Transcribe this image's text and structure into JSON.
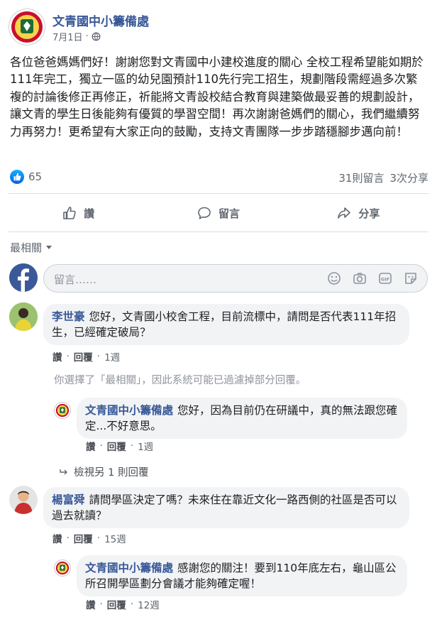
{
  "post": {
    "page_name": "文青國中小籌備處",
    "date": "7月1日",
    "privacy_icon": "globe-icon",
    "text": "各位爸爸媽媽們好！謝謝您對文青國中小建校進度的關心 全校工程希望能如期於111年完工，獨立一區的幼兒園預計110先行完工招生，規劃階段需經過多次繁複的討論後修正再修正，祈能將文青設校結合教育與建築做最妥善的規劃設計，讓文青的學生日後能夠有優質的學習空間！再次謝謝爸媽們的關心，我們繼續努力再努力！更希望有大家正向的鼓勵，支持文青團隊一步步踏穩腳步邁向前！",
    "reaction_count": "65",
    "comment_count": "31則留言",
    "share_count": "3次分享"
  },
  "actions": {
    "like": "讚",
    "comment": "留言",
    "share": "分享"
  },
  "sort": {
    "label": "最相關"
  },
  "composer": {
    "placeholder": "留言……"
  },
  "comments": [
    {
      "author": "李世豪",
      "text": "您好，文青國小校舍工程，目前流標中，請問是否代表111年招生，已經確定破局？",
      "like_label": "讚",
      "reply_label": "回覆",
      "time": "1週",
      "filter_note": "你選擇了「最相關」，因此系統可能已過濾掉部分回覆。",
      "reply": {
        "author": "文青國中小籌備處",
        "text": "您好，因為目前仍在研議中，真的無法跟您確定...不好意思。",
        "like_label": "讚",
        "reply_label": "回覆",
        "time": "1週"
      },
      "more_replies": "檢視另 1 則回覆"
    },
    {
      "author": "楊富舜",
      "text": "請問學區決定了嗎？未來住在靠近文化一路西側的社區是否可以過去就讀？",
      "like_label": "讚",
      "reply_label": "回覆",
      "time": "15週",
      "reply": {
        "author": "文青國中小籌備處",
        "text": "感謝您的關注！要到110年底左右，龜山區公所召開學區劃分會議才能夠確定喔！",
        "like_label": "讚",
        "reply_label": "回覆",
        "time": "12週"
      }
    }
  ],
  "colors": {
    "link": "#385898",
    "meta": "#606770",
    "bubble": "#f2f3f5",
    "like_blue": "#1877f2"
  }
}
